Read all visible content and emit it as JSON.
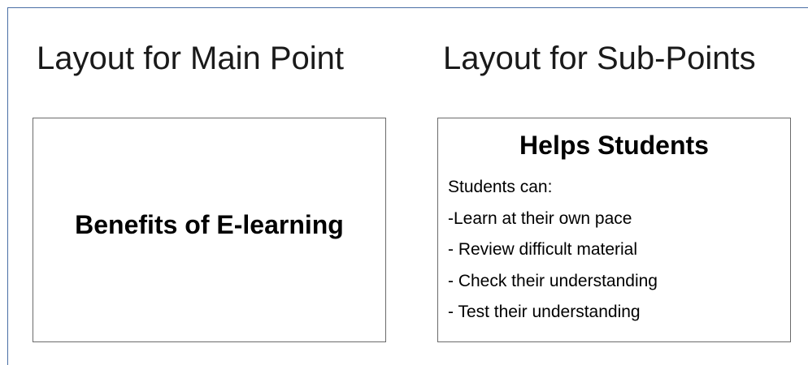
{
  "left_column": {
    "title": "Layout for Main Point",
    "box_text": "Benefits of E-learning"
  },
  "right_column": {
    "title": "Layout for Sub-Points",
    "heading": "Helps Students",
    "lines": [
      "Students can:",
      "-Learn at their own pace",
      "- Review difficult material",
      "- Check their understanding",
      "- Test their understanding"
    ]
  },
  "colors": {
    "frame_border": "#4a6fa5",
    "box_border": "#6b6b6b",
    "text": "#000000"
  }
}
